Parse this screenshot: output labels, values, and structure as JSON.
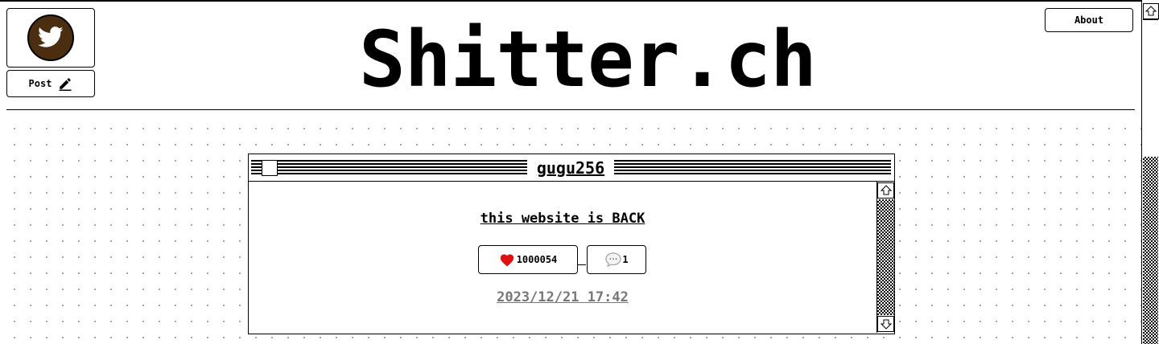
{
  "header": {
    "site_title": "Shitter.ch",
    "post_label": "Post",
    "about_label": "About"
  },
  "post": {
    "username": "gugu256",
    "text": "this website is BACK",
    "likes": "1000054",
    "comments": "1",
    "timestamp": "2023/12/21 17:42"
  },
  "colors": {
    "logo_background": "#4a2e0f",
    "like_heart": "#e01010",
    "timestamp_text": "#777777"
  },
  "icons": [
    "bird-icon",
    "pencil-icon",
    "heart-icon",
    "speech-bubble-icon",
    "scroll-up-arrow-icon",
    "scroll-down-arrow-icon"
  ]
}
